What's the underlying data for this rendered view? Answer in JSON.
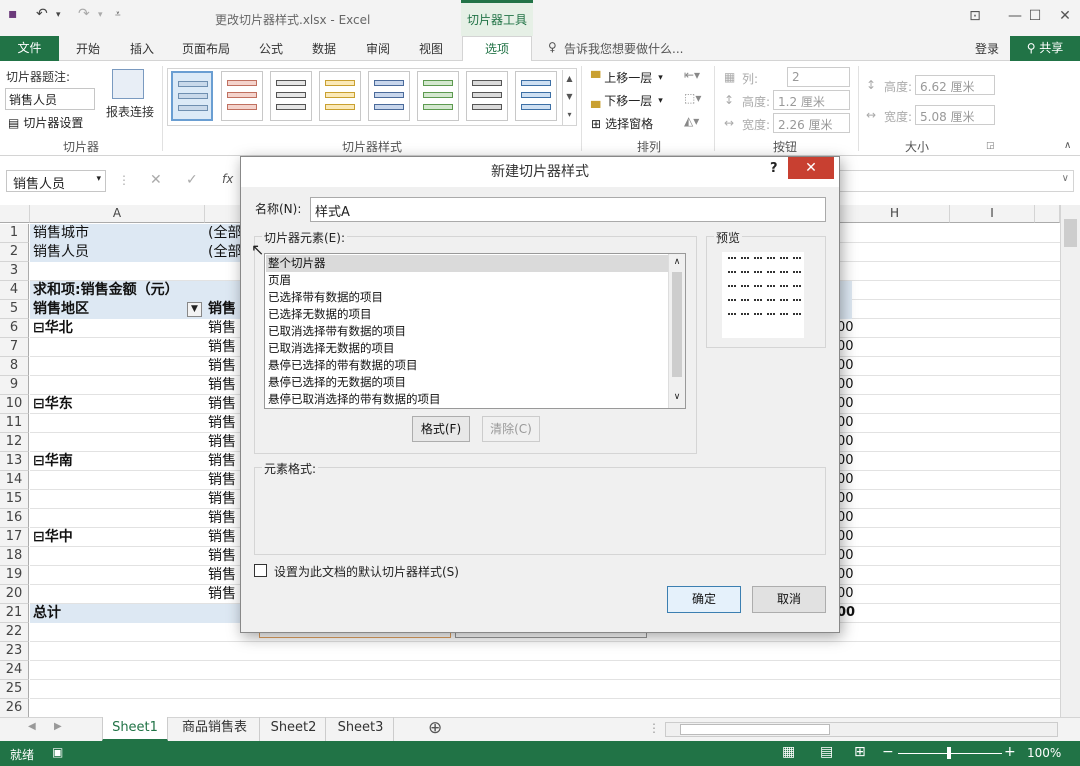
{
  "window": {
    "title": "更改切片器样式.xlsx - Excel",
    "context_tab_group": "切片器工具"
  },
  "menu": {
    "file": "文件",
    "tabs": [
      "开始",
      "插入",
      "页面布局",
      "公式",
      "数据",
      "审阅",
      "视图"
    ],
    "active_tab": "选项",
    "tell_me": "告诉我您想要做什么...",
    "login": "登录",
    "share": "共享"
  },
  "ribbon": {
    "slicer_caption_label": "切片器题注:",
    "slicer_caption_value": "销售人员",
    "slicer_settings": "切片器设置",
    "report_connections": "报表连接",
    "group_slicer": "切片器",
    "group_styles": "切片器样式",
    "bring_forward": "上移一层",
    "send_backward": "下移一层",
    "selection_pane": "选择窗格",
    "group_arrange": "排列",
    "columns_label": "列:",
    "columns_value": "2",
    "btn_height_label": "高度:",
    "btn_height_value": "1.2 厘米",
    "btn_width_label": "宽度:",
    "btn_width_value": "2.26 厘米",
    "group_buttons": "按钮",
    "size_height_label": "高度:",
    "size_height_value": "6.62 厘米",
    "size_width_label": "宽度:",
    "size_width_value": "5.08 厘米",
    "group_size": "大小"
  },
  "formula_bar": {
    "name_box": "销售人员",
    "fx": "fx"
  },
  "grid": {
    "columns": [
      "A",
      "H",
      "I"
    ],
    "rows": [
      "1",
      "2",
      "3",
      "4",
      "5",
      "6",
      "7",
      "8",
      "9",
      "10",
      "11",
      "12",
      "13",
      "14",
      "15",
      "16",
      "17",
      "18",
      "19",
      "20",
      "21",
      "22",
      "23",
      "24",
      "25",
      "26"
    ],
    "a_cells": {
      "r1": "销售城市",
      "r2": "销售人员",
      "r4": "求和项:销售金额（元）",
      "r5": "销售地区",
      "r6": "华北",
      "r10": "华东",
      "r13": "华南",
      "r17": "华中",
      "r21": "总计"
    },
    "b_partial": {
      "all": "(全部",
      "sales_hdr": "销售",
      "sales": "销售"
    },
    "right_partial": "00"
  },
  "sheets": {
    "tabs": [
      "Sheet1",
      "商品销售表",
      "Sheet2",
      "Sheet3"
    ],
    "active": "Sheet1"
  },
  "status": {
    "ready": "就绪",
    "zoom": "100%"
  },
  "dialog": {
    "title": "新建切片器样式",
    "help": "?",
    "close": "✕",
    "name_label": "名称(N):",
    "name_value": "样式A",
    "elements_label": "切片器元素(E):",
    "elements": [
      "整个切片器",
      "页眉",
      "已选择带有数据的项目",
      "已选择无数据的项目",
      "已取消选择带有数据的项目",
      "已取消选择无数据的项目",
      "悬停已选择的带有数据的项目",
      "悬停已选择的无数据的项目",
      "悬停已取消选择的带有数据的项目"
    ],
    "format_btn": "格式(F)",
    "clear_btn": "清除(C)",
    "preview_label": "预览",
    "element_format_label": "元素格式:",
    "default_checkbox": "设置为此文档的默认切片器样式(S)",
    "ok": "确定",
    "cancel": "取消"
  },
  "colors": {
    "excel_green": "#217346",
    "highlight": "#dde8f3",
    "close_red": "#c84031"
  }
}
